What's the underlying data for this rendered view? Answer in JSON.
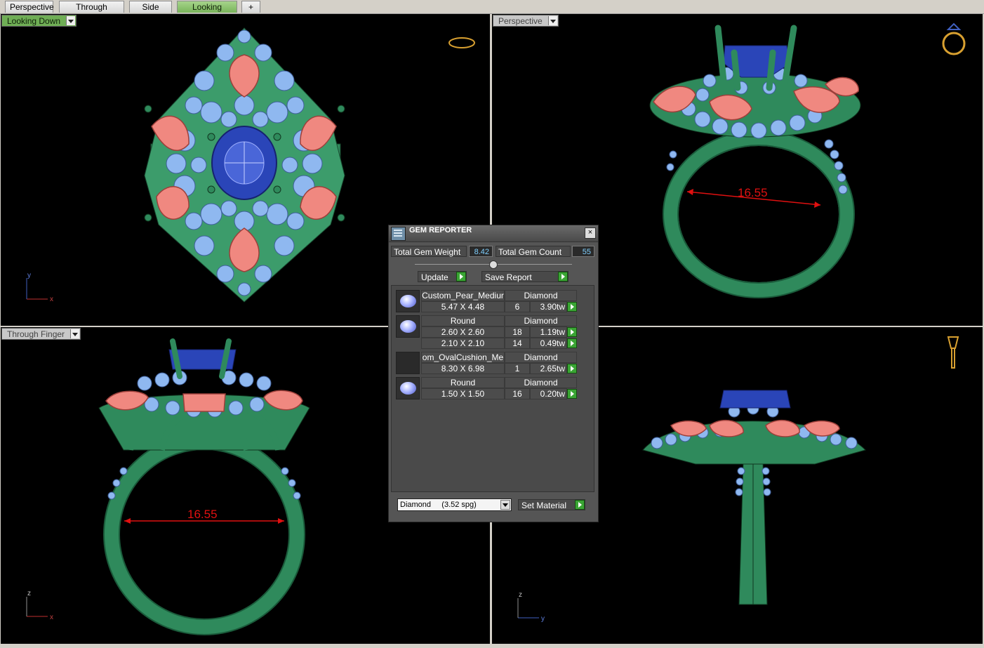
{
  "tabs": [
    {
      "label": "Perspective",
      "active": false
    },
    {
      "label": "Through Finger",
      "active": false
    },
    {
      "label": "Side View",
      "active": false
    },
    {
      "label": "Looking Down",
      "active": true
    }
  ],
  "viewports": {
    "top_left": {
      "label": "Looking Down",
      "axis_h": "x",
      "axis_v": "y"
    },
    "top_right": {
      "label": "Perspective",
      "dimension": "16.55"
    },
    "bottom_left": {
      "label": "Through Finger",
      "dimension": "16.55",
      "axis_h": "x",
      "axis_v": "z"
    },
    "bottom_right": {
      "label": "",
      "axis_h": "y",
      "axis_v": "z"
    }
  },
  "colors": {
    "metal": "#2f8a5c",
    "metal_light": "#4fb282",
    "side_stones": "#8fb8f0",
    "pear_stones": "#f08880",
    "center_stone": "#2a45b8",
    "dimension": "#e01010",
    "active_tab": "#79b45a"
  },
  "gem_reporter": {
    "title": "GEM REPORTER",
    "close_label": "×",
    "total_weight_label": "Total Gem Weight",
    "total_weight_value": "8.42",
    "total_count_label": "Total Gem Count",
    "total_count_value": "55",
    "update_label": "Update",
    "save_report_label": "Save Report",
    "groups": [
      {
        "shape": "Custom_Pear_Mediur",
        "material": "Diamond",
        "rows": [
          {
            "size": "5.47 X 4.48",
            "count": "6",
            "weight": "3.90tw"
          }
        ]
      },
      {
        "shape": "Round",
        "material": "Diamond",
        "rows": [
          {
            "size": "2.60 X 2.60",
            "count": "18",
            "weight": "1.19tw"
          },
          {
            "size": "2.10 X 2.10",
            "count": "14",
            "weight": "0.49tw"
          }
        ]
      },
      {
        "shape": "om_OvalCushion_Me",
        "material": "Diamond",
        "rows": [
          {
            "size": "8.30 X 6.98",
            "count": "1",
            "weight": "2.65tw"
          }
        ]
      },
      {
        "shape": "Round",
        "material": "Diamond",
        "rows": [
          {
            "size": "1.50 X 1.50",
            "count": "16",
            "weight": "0.20tw"
          }
        ]
      }
    ],
    "material_select": "Diamond     (3.52 spg)",
    "set_material_label": "Set Material"
  }
}
